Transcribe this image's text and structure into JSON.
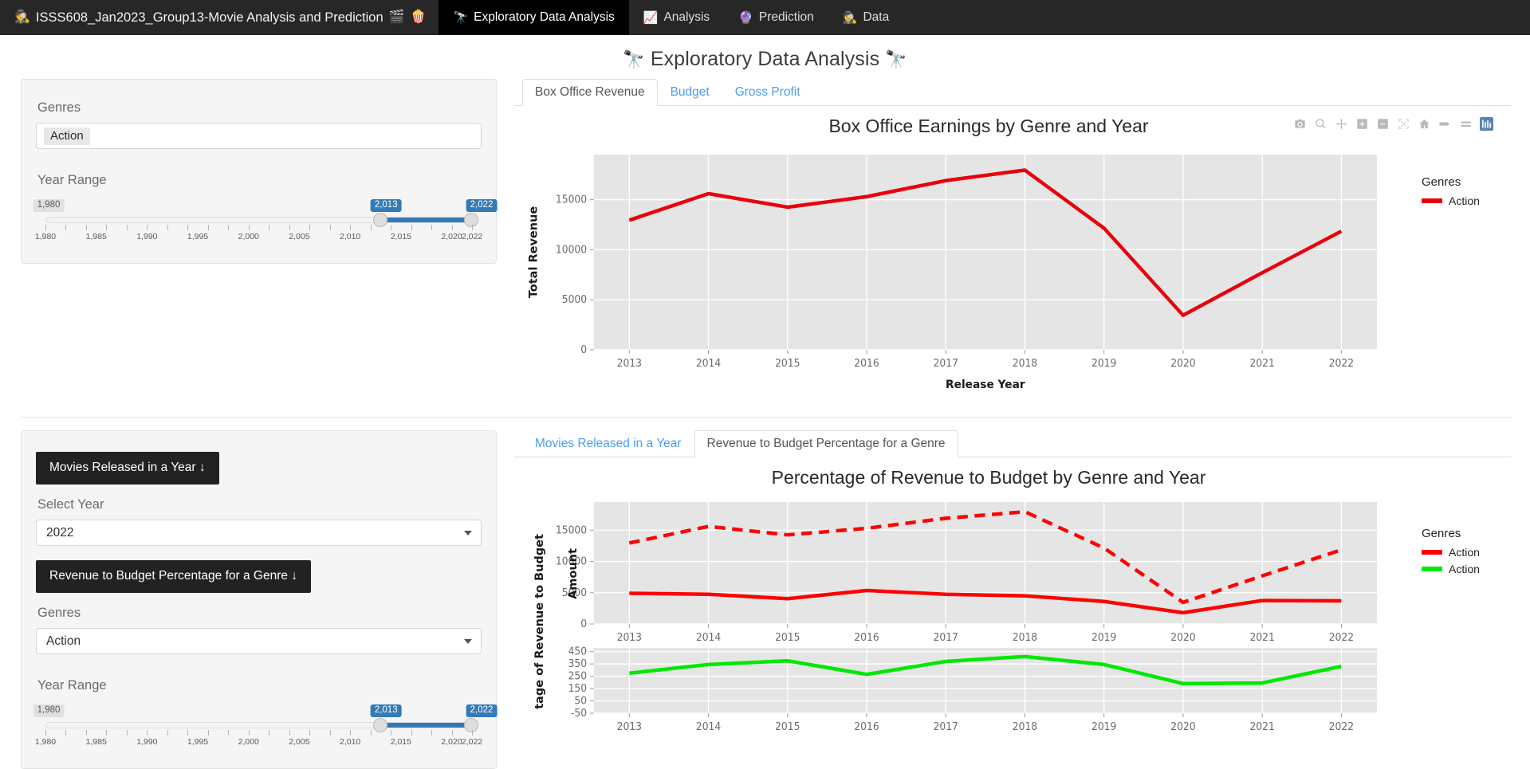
{
  "navbar": {
    "brand": {
      "label": "ISSS608_Jan2023_Group13-Movie Analysis and Prediction",
      "lead_icon": "detective-icon",
      "lead_emoji": "🕵",
      "trail_emoji_1": "🎬",
      "trail_emoji_2": "🍿"
    },
    "items": [
      {
        "label": "Exploratory Data Analysis",
        "emoji": "🔭",
        "icon": "telescope-icon",
        "active": true
      },
      {
        "label": "Analysis",
        "emoji": "📈",
        "icon": "chart-increasing-icon",
        "active": false
      },
      {
        "label": "Prediction",
        "emoji": "🔮",
        "icon": "crystal-ball-icon",
        "active": false
      },
      {
        "label": "Data",
        "emoji": "🕵",
        "icon": "detective-icon",
        "active": false
      }
    ]
  },
  "page": {
    "title": "Exploratory Data Analysis",
    "title_emoji": "🔭"
  },
  "panel1": {
    "genres_label": "Genres",
    "genres_value": "Action",
    "year_range_label": "Year Range",
    "slider": {
      "min_label": "1,980",
      "low_label": "2,013",
      "high_label": "2,022",
      "min": 1980,
      "max": 2022,
      "low": 2013,
      "high": 2022,
      "tick_labels": [
        "1,980",
        "1,985",
        "1,990",
        "1,995",
        "2,000",
        "2,005",
        "2,010",
        "2,015",
        "2,020",
        "2,022"
      ],
      "tick_values": [
        1980,
        1985,
        1990,
        1995,
        2000,
        2005,
        2010,
        2015,
        2020,
        2022
      ]
    }
  },
  "panel2": {
    "button1": "Movies Released in a Year ↓",
    "select_year_label": "Select Year",
    "select_year_value": "2022",
    "button2": "Revenue to Budget Percentage for a Genre ↓",
    "genres_label": "Genres",
    "genres_value": "Action",
    "year_range_label": "Year Range",
    "slider": {
      "min_label": "1,980",
      "low_label": "2,013",
      "high_label": "2,022",
      "min": 1980,
      "max": 2022,
      "low": 2013,
      "high": 2022,
      "tick_labels": [
        "1,980",
        "1,985",
        "1,990",
        "1,995",
        "2,000",
        "2,005",
        "2,010",
        "2,015",
        "2,020",
        "2,022"
      ],
      "tick_values": [
        1980,
        1985,
        1990,
        1995,
        2000,
        2005,
        2010,
        2015,
        2020,
        2022
      ]
    }
  },
  "tabs_top": [
    {
      "label": "Box Office Revenue",
      "active": true
    },
    {
      "label": "Budget",
      "active": false
    },
    {
      "label": "Gross Profit",
      "active": false
    }
  ],
  "tabs_bottom": [
    {
      "label": "Movies Released in a Year",
      "active": false
    },
    {
      "label": "Revenue to Budget Percentage for a Genre",
      "active": true
    }
  ],
  "modebar": {
    "icons": [
      "camera-icon",
      "zoom-icon",
      "pan-icon",
      "zoom-in-icon",
      "zoom-out-icon",
      "autoscale-icon",
      "home-icon",
      "spike-lines-icon",
      "hover-compare-icon",
      "bar-chart-icon"
    ],
    "active_icon": "bar-chart-icon",
    "active_color": "#3b6fa0"
  },
  "legend_top": {
    "title": "Genres",
    "entries": [
      {
        "label": "Action",
        "color": "#E8000B"
      }
    ]
  },
  "legend_bottom": {
    "title": "Genres",
    "entries": [
      {
        "label": "Action",
        "color": "#FF0000"
      },
      {
        "label": "Action",
        "color": "#00E800"
      }
    ]
  },
  "chart_data": [
    {
      "type": "line",
      "id": "box-office-earnings",
      "title": "Box Office Earnings by Genre and Year",
      "xlabel": "Release Year",
      "ylabel": "Total Revenue",
      "x": [
        2013,
        2014,
        2015,
        2016,
        2017,
        2018,
        2019,
        2020,
        2021,
        2022
      ],
      "xticks": [
        "2013",
        "2014",
        "2015",
        "2016",
        "2017",
        "2018",
        "2019",
        "2020",
        "2021",
        "2022"
      ],
      "yticks": [
        0,
        5000,
        10000,
        15000
      ],
      "ytick_labels": [
        "0",
        "5000",
        "10000",
        "15000"
      ],
      "ylim": [
        0,
        19500
      ],
      "grid": true,
      "legend_position": "right",
      "plot_bgcolor": "#E5E5E5",
      "gridcolor": "#FFFFFF",
      "series": [
        {
          "name": "Action",
          "color": "#E8000B",
          "dash": "solid",
          "values": [
            12950,
            15600,
            14250,
            15300,
            16900,
            17950,
            12150,
            3450,
            7700,
            11850
          ]
        }
      ]
    },
    {
      "type": "line",
      "id": "revenue-to-budget-percentage",
      "title": "Percentage of Revenue to Budget by Genre and Year",
      "xlabel": "",
      "ylabel_top": "Amount",
      "ylabel_bottom": "tage of Revenue to Budget",
      "x": [
        2013,
        2014,
        2015,
        2016,
        2017,
        2018,
        2019,
        2020,
        2021,
        2022
      ],
      "xticks": [
        "2013",
        "2014",
        "2015",
        "2016",
        "2017",
        "2018",
        "2019",
        "2020",
        "2021",
        "2022"
      ],
      "grid": true,
      "legend_position": "right",
      "plot_bgcolor": "#E5E5E5",
      "gridcolor": "#FFFFFF",
      "subplots": [
        {
          "name": "amount",
          "yticks": [
            0,
            5000,
            10000,
            15000
          ],
          "ytick_labels": [
            "0",
            "5000",
            "10000",
            "15000"
          ],
          "ylim": [
            0,
            19500
          ],
          "series": [
            {
              "name": "Action",
              "color": "#FF0000",
              "dash": "dashed",
              "values": [
                12950,
                15600,
                14250,
                15300,
                16900,
                17950,
                12150,
                3450,
                7700,
                11850
              ]
            },
            {
              "name": "Action",
              "color": "#FF0000",
              "dash": "solid",
              "values": [
                4900,
                4750,
                4050,
                5350,
                4750,
                4500,
                3600,
                1800,
                3750,
                3700
              ]
            }
          ]
        },
        {
          "name": "percentage",
          "yticks": [
            -50,
            50,
            150,
            250,
            350,
            450
          ],
          "ytick_labels": [
            "-50",
            "50",
            "150",
            "250",
            "350",
            "450"
          ],
          "ylim": [
            -50,
            480
          ],
          "series": [
            {
              "name": "Action",
              "color": "#00E800",
              "dash": "solid",
              "values": [
                275,
                345,
                375,
                265,
                370,
                410,
                345,
                190,
                195,
                330
              ]
            }
          ]
        }
      ]
    }
  ]
}
